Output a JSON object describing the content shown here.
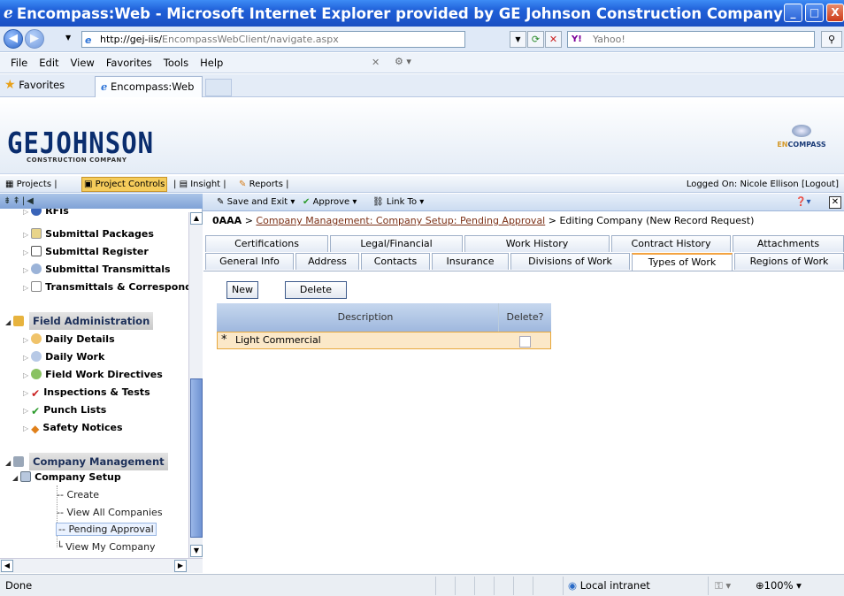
{
  "window": {
    "title": "Encompass:Web - Microsoft Internet Explorer provided by GE Johnson Construction Company"
  },
  "browser": {
    "url_host": "http://gej-iis/",
    "url_path": "EncompassWebClient/navigate.aspx",
    "search_placeholder": "Yahoo!",
    "search_brand": "Y!",
    "menu": [
      "File",
      "Edit",
      "View",
      "Favorites",
      "Tools",
      "Help"
    ],
    "favorites_label": "Favorites",
    "tab_title": "Encompass:Web"
  },
  "app": {
    "logo_main": "GEJOHNSON",
    "logo_sub": "CONSTRUCTION COMPANY",
    "encompass_pre": "EN",
    "encompass_post": "COMPASS",
    "nav": [
      "Projects",
      "Project Controls",
      "Insight",
      "Reports"
    ],
    "logged_on": "Logged On: Nicole Ellison",
    "logout": "[Logout]"
  },
  "toolbar": {
    "save_exit": "Save and Exit",
    "approve": "Approve",
    "link_to": "Link To"
  },
  "breadcrumb": {
    "code": "0AAA",
    "sep": ">",
    "link": "Company Management: Company Setup: Pending Approval",
    "current": "Editing Company (New Record Request)"
  },
  "tabs_row1": [
    "Certifications",
    "Legal/Financial",
    "Work History",
    "Contract History",
    "Attachments"
  ],
  "tabs_row2": [
    "General Info",
    "Address",
    "Contacts",
    "Insurance",
    "Divisions of Work",
    "Types of Work",
    "Regions of Work"
  ],
  "active_tab": "Types of Work",
  "buttons": {
    "new": "New",
    "delete": "Delete"
  },
  "grid": {
    "headers": [
      "Description",
      "Delete?"
    ],
    "rows": [
      {
        "marker": "*",
        "description": "Light Commercial",
        "delete": false
      }
    ]
  },
  "sidebar": {
    "items_top": [
      "RFIs",
      "Submittal Packages",
      "Submittal Register",
      "Submittal Transmittals",
      "Transmittals & Correspond"
    ],
    "field_admin": "Field Administration",
    "field_items": [
      "Daily Details",
      "Daily Work",
      "Field Work Directives",
      "Inspections & Tests",
      "Punch Lists",
      "Safety Notices"
    ],
    "company_mgmt": "Company Management",
    "company_setup": "Company Setup",
    "setup_items": [
      "Create",
      "View All Companies",
      "Pending Approval",
      "View My Company"
    ],
    "selected": "Pending Approval"
  },
  "status": {
    "text": "Done",
    "zone": "Local intranet",
    "zoom": "100%"
  },
  "colors": {
    "titlebar": "#1f5fd8",
    "active_nav": "#f5cc5b",
    "grid_row": "#fbe8c8",
    "link": "#7b3016"
  }
}
